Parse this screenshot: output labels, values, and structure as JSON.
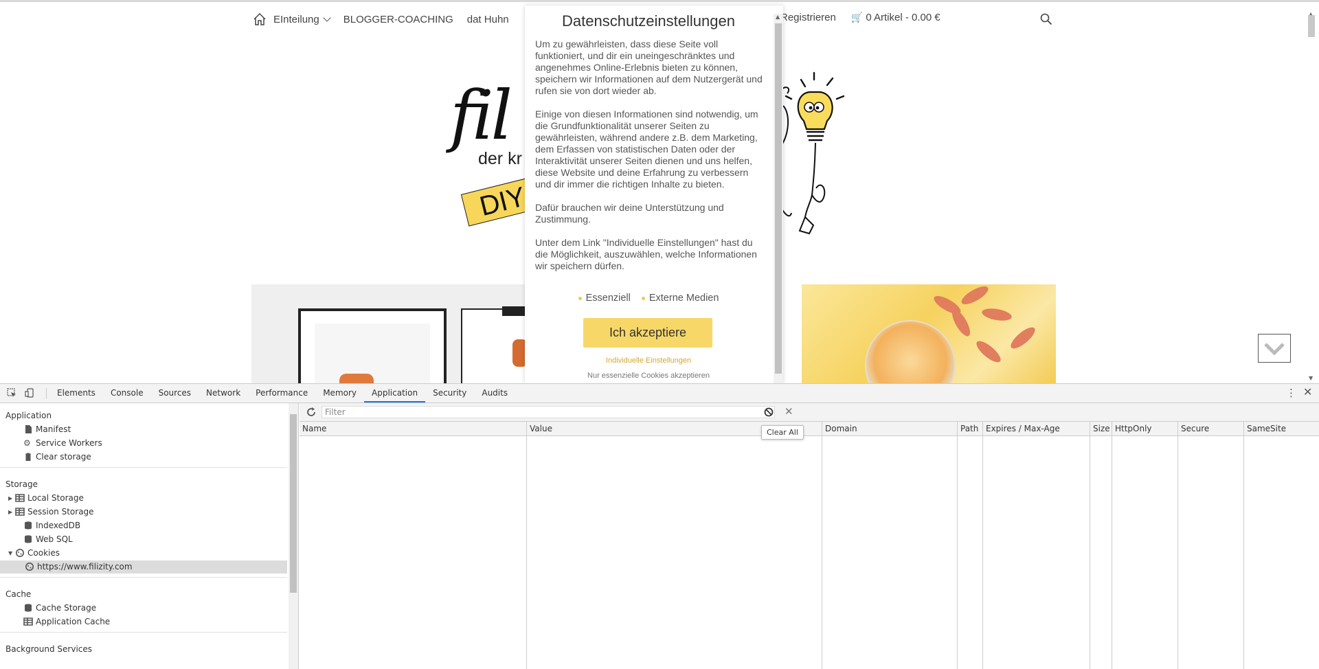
{
  "site": {
    "nav": {
      "items": [
        "EInteilung",
        "BLOGGER-COACHING",
        "dat Huhn"
      ],
      "register": "Registrieren",
      "cart": "0 Artikel - 0.00 €"
    },
    "logo": {
      "script": "fil",
      "tagline": "der kr",
      "badge": "DIY"
    }
  },
  "consent": {
    "title": "Datenschutzeinstellungen",
    "paragraphs": [
      "Um zu gewährleisten, dass diese Seite voll funktioniert, und dir ein uneingeschränktes und angenehmes Online-Erlebnis bieten zu können, speichern wir Informationen auf dem Nutzergerät und rufen sie von dort wieder ab.",
      "Einige von diesen Informationen sind notwendig, um die Grundfunktionalität unserer Seiten zu gewährleisten, während andere z.B. dem Marketing, dem Erfassen von statistischen Daten oder der Interaktivität unserer Seiten dienen und uns helfen, diese Website und deine Erfahrung zu verbessern und dir immer die richtigen Inhalte zu bieten.",
      "Dafür brauchen wir deine Unterstützung und Zustimmung.",
      "Unter dem Link \"Individuelle Einstellungen\" hast du die Möglichkeit, auszuwählen, welche Informationen wir speichern dürfen."
    ],
    "options": [
      "Essenziell",
      "Externe Medien"
    ],
    "accept_label": "Ich akzeptiere",
    "individual_label": "Individuelle Einstellungen",
    "essential_only_label": "Nur essenzielle Cookies akzeptieren",
    "accent_color": "#f7d767"
  },
  "devtools": {
    "tabs": [
      "Elements",
      "Console",
      "Sources",
      "Network",
      "Performance",
      "Memory",
      "Application",
      "Security",
      "Audits"
    ],
    "active_tab": "Application",
    "sidebar": {
      "application": {
        "title": "Application",
        "items": [
          "Manifest",
          "Service Workers",
          "Clear storage"
        ]
      },
      "storage": {
        "title": "Storage",
        "items": [
          "Local Storage",
          "Session Storage",
          "IndexedDB",
          "Web SQL",
          "Cookies"
        ],
        "cookie_origin": "https://www.filizity.com"
      },
      "cache": {
        "title": "Cache",
        "items": [
          "Cache Storage",
          "Application Cache"
        ]
      },
      "background": {
        "title": "Background Services"
      }
    },
    "cookies": {
      "filter_placeholder": "Filter",
      "tooltip": "Clear All",
      "columns": [
        "Name",
        "Value",
        "Domain",
        "Path",
        "Expires / Max-Age",
        "Size",
        "HttpOnly",
        "Secure",
        "SameSite"
      ]
    }
  }
}
